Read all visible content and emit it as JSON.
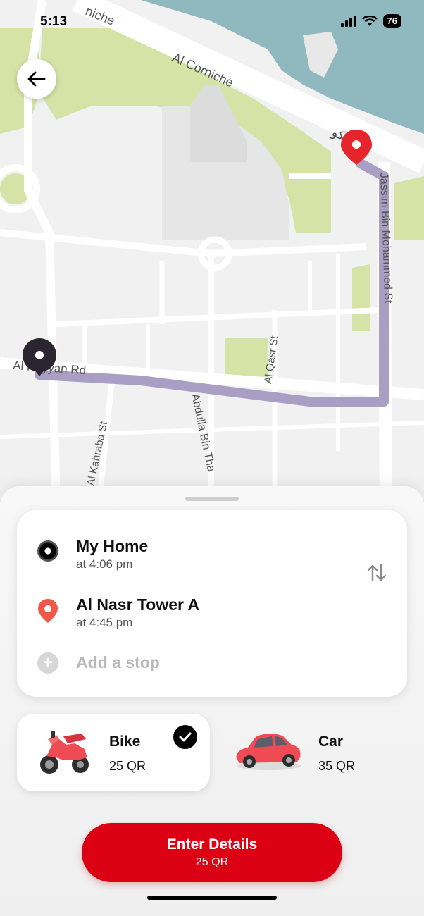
{
  "status_bar": {
    "time": "5:13",
    "battery": "76"
  },
  "map": {
    "streets": {
      "corniche": "Al Corniche",
      "corniche_top": "niche",
      "rayyan": "Al Rayyan Rd",
      "jassim": "Jassim Bin Mohammed St",
      "qasr": "Al Qasr St",
      "kahraba": "Al Kahraba St",
      "abdulla": "Abdulla Bin Tha",
      "arabic": "الكو"
    },
    "colors": {
      "water": "#8fb8bf",
      "park": "#d6e2a6",
      "route": "#a99ec4",
      "pin": "#e5252b"
    }
  },
  "route": {
    "origin": {
      "name": "My Home",
      "time": "at 4:06 pm"
    },
    "destination": {
      "name": "Al Nasr Tower A",
      "time": "at 4:45 pm"
    },
    "add_stop": "Add a stop",
    "add_icon": "+"
  },
  "vehicles": [
    {
      "name": "Bike",
      "price": "25 QR",
      "selected": true
    },
    {
      "name": "Car",
      "price": "35 QR",
      "selected": false
    }
  ],
  "cta": {
    "label": "Enter Details",
    "price": "25 QR"
  },
  "theme": {
    "accent": "#dc0014"
  }
}
